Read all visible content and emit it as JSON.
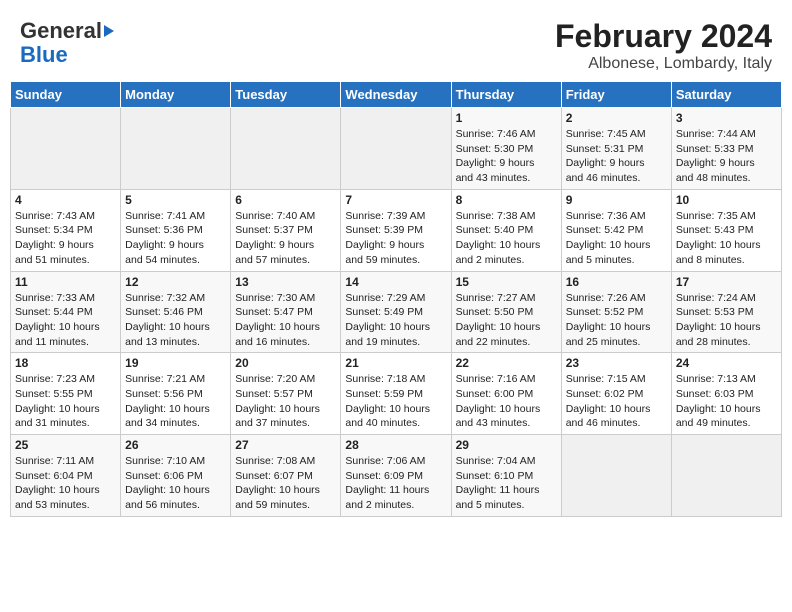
{
  "header": {
    "logo_line1": "General",
    "logo_line2": "Blue",
    "month_title": "February 2024",
    "location": "Albonese, Lombardy, Italy"
  },
  "calendar": {
    "days_of_week": [
      "Sunday",
      "Monday",
      "Tuesday",
      "Wednesday",
      "Thursday",
      "Friday",
      "Saturday"
    ],
    "weeks": [
      [
        {
          "day": "",
          "content": ""
        },
        {
          "day": "",
          "content": ""
        },
        {
          "day": "",
          "content": ""
        },
        {
          "day": "",
          "content": ""
        },
        {
          "day": "1",
          "content": "Sunrise: 7:46 AM\nSunset: 5:30 PM\nDaylight: 9 hours\nand 43 minutes."
        },
        {
          "day": "2",
          "content": "Sunrise: 7:45 AM\nSunset: 5:31 PM\nDaylight: 9 hours\nand 46 minutes."
        },
        {
          "day": "3",
          "content": "Sunrise: 7:44 AM\nSunset: 5:33 PM\nDaylight: 9 hours\nand 48 minutes."
        }
      ],
      [
        {
          "day": "4",
          "content": "Sunrise: 7:43 AM\nSunset: 5:34 PM\nDaylight: 9 hours\nand 51 minutes."
        },
        {
          "day": "5",
          "content": "Sunrise: 7:41 AM\nSunset: 5:36 PM\nDaylight: 9 hours\nand 54 minutes."
        },
        {
          "day": "6",
          "content": "Sunrise: 7:40 AM\nSunset: 5:37 PM\nDaylight: 9 hours\nand 57 minutes."
        },
        {
          "day": "7",
          "content": "Sunrise: 7:39 AM\nSunset: 5:39 PM\nDaylight: 9 hours\nand 59 minutes."
        },
        {
          "day": "8",
          "content": "Sunrise: 7:38 AM\nSunset: 5:40 PM\nDaylight: 10 hours\nand 2 minutes."
        },
        {
          "day": "9",
          "content": "Sunrise: 7:36 AM\nSunset: 5:42 PM\nDaylight: 10 hours\nand 5 minutes."
        },
        {
          "day": "10",
          "content": "Sunrise: 7:35 AM\nSunset: 5:43 PM\nDaylight: 10 hours\nand 8 minutes."
        }
      ],
      [
        {
          "day": "11",
          "content": "Sunrise: 7:33 AM\nSunset: 5:44 PM\nDaylight: 10 hours\nand 11 minutes."
        },
        {
          "day": "12",
          "content": "Sunrise: 7:32 AM\nSunset: 5:46 PM\nDaylight: 10 hours\nand 13 minutes."
        },
        {
          "day": "13",
          "content": "Sunrise: 7:30 AM\nSunset: 5:47 PM\nDaylight: 10 hours\nand 16 minutes."
        },
        {
          "day": "14",
          "content": "Sunrise: 7:29 AM\nSunset: 5:49 PM\nDaylight: 10 hours\nand 19 minutes."
        },
        {
          "day": "15",
          "content": "Sunrise: 7:27 AM\nSunset: 5:50 PM\nDaylight: 10 hours\nand 22 minutes."
        },
        {
          "day": "16",
          "content": "Sunrise: 7:26 AM\nSunset: 5:52 PM\nDaylight: 10 hours\nand 25 minutes."
        },
        {
          "day": "17",
          "content": "Sunrise: 7:24 AM\nSunset: 5:53 PM\nDaylight: 10 hours\nand 28 minutes."
        }
      ],
      [
        {
          "day": "18",
          "content": "Sunrise: 7:23 AM\nSunset: 5:55 PM\nDaylight: 10 hours\nand 31 minutes."
        },
        {
          "day": "19",
          "content": "Sunrise: 7:21 AM\nSunset: 5:56 PM\nDaylight: 10 hours\nand 34 minutes."
        },
        {
          "day": "20",
          "content": "Sunrise: 7:20 AM\nSunset: 5:57 PM\nDaylight: 10 hours\nand 37 minutes."
        },
        {
          "day": "21",
          "content": "Sunrise: 7:18 AM\nSunset: 5:59 PM\nDaylight: 10 hours\nand 40 minutes."
        },
        {
          "day": "22",
          "content": "Sunrise: 7:16 AM\nSunset: 6:00 PM\nDaylight: 10 hours\nand 43 minutes."
        },
        {
          "day": "23",
          "content": "Sunrise: 7:15 AM\nSunset: 6:02 PM\nDaylight: 10 hours\nand 46 minutes."
        },
        {
          "day": "24",
          "content": "Sunrise: 7:13 AM\nSunset: 6:03 PM\nDaylight: 10 hours\nand 49 minutes."
        }
      ],
      [
        {
          "day": "25",
          "content": "Sunrise: 7:11 AM\nSunset: 6:04 PM\nDaylight: 10 hours\nand 53 minutes."
        },
        {
          "day": "26",
          "content": "Sunrise: 7:10 AM\nSunset: 6:06 PM\nDaylight: 10 hours\nand 56 minutes."
        },
        {
          "day": "27",
          "content": "Sunrise: 7:08 AM\nSunset: 6:07 PM\nDaylight: 10 hours\nand 59 minutes."
        },
        {
          "day": "28",
          "content": "Sunrise: 7:06 AM\nSunset: 6:09 PM\nDaylight: 11 hours\nand 2 minutes."
        },
        {
          "day": "29",
          "content": "Sunrise: 7:04 AM\nSunset: 6:10 PM\nDaylight: 11 hours\nand 5 minutes."
        },
        {
          "day": "",
          "content": ""
        },
        {
          "day": "",
          "content": ""
        }
      ]
    ]
  }
}
